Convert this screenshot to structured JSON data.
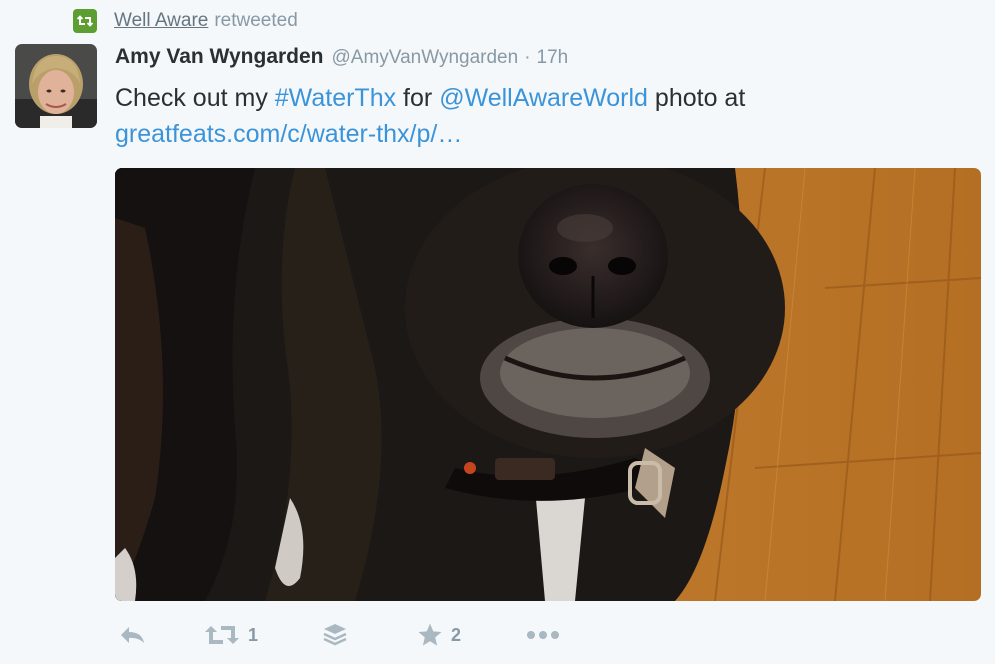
{
  "retweet_context": {
    "user": "Well Aware",
    "action": "retweeted"
  },
  "tweet": {
    "fullname": "Amy Van Wyngarden",
    "screenname": "@AmyVanWyngarden",
    "separator": "·",
    "time": "17h",
    "text": {
      "part1": "Check out my ",
      "hashtag": "#WaterThx",
      "part2": " for ",
      "mention": "@WellAwareWorld",
      "part3": " photo at",
      "link": "greatfeats.com/c/water-thx/p/…"
    },
    "media_description": "Close-up photo of a black dog's nose and collar on a wooden floor"
  },
  "actions": {
    "reply_icon": "reply-icon",
    "retweet_icon": "retweet-icon",
    "retweet_count": "1",
    "stack_icon": "stack-icon",
    "favorite_icon": "star-icon",
    "favorite_count": "2",
    "more_icon": "more-icon"
  },
  "colors": {
    "link": "#3b94d9",
    "retweet_badge": "#5c9e31",
    "muted": "#8899a6",
    "text": "#292f33",
    "background": "#f5f8fa"
  }
}
